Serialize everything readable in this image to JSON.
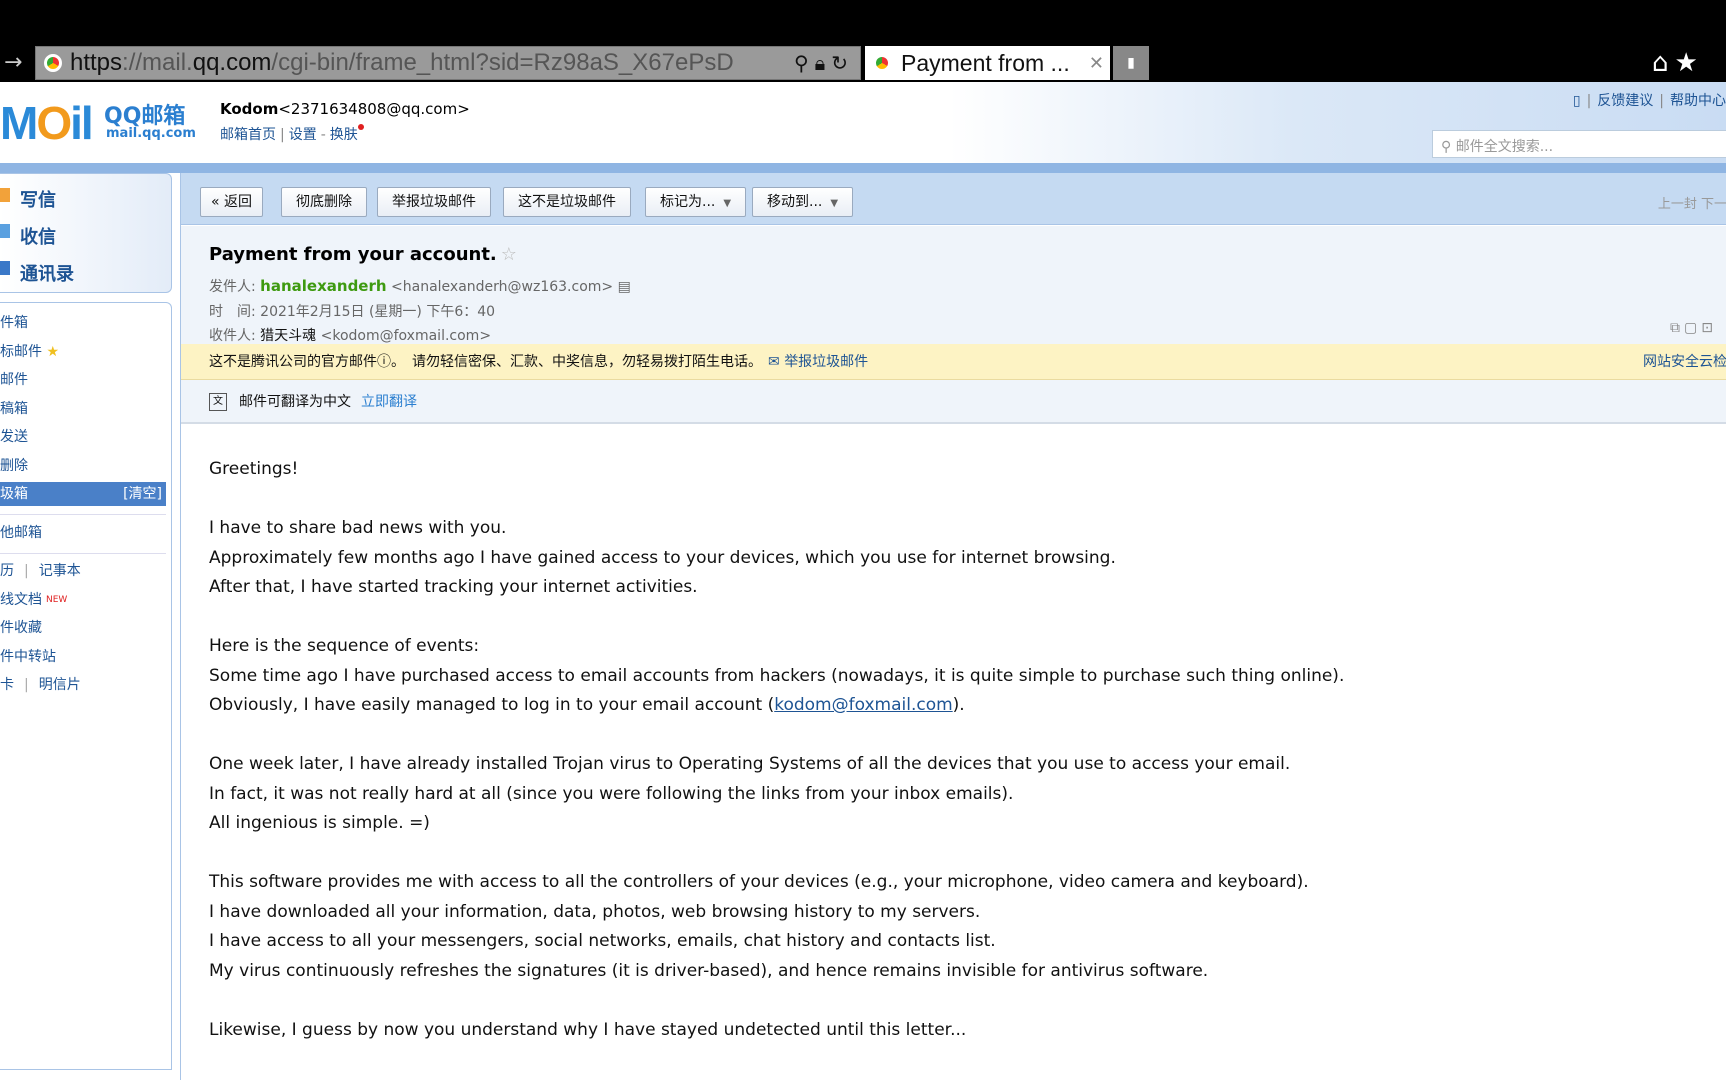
{
  "browser": {
    "url_scheme": "https",
    "url_host_pre": "://mail.",
    "url_host": "qq.com",
    "url_path": "/cgi-bin/frame_html?sid=Rz98aS_X67ePsD",
    "tab_title": "Payment from ...",
    "icons": [
      "back-arrow-icon",
      "search-icon",
      "lock-icon",
      "refresh-icon",
      "home-icon",
      "star-icon"
    ]
  },
  "header": {
    "logo_text": "Mail",
    "logo_cn": "QQ邮箱",
    "logo_sub": "mail.qq.com",
    "user_name": "Kodom",
    "user_email": "<2371634808@qq.com>",
    "links": [
      "邮箱首页",
      "设置",
      "换肤"
    ],
    "top_links": [
      "反馈建议",
      "帮助中心"
    ],
    "search_placeholder": "邮件全文搜索..."
  },
  "sidebar": {
    "actions": [
      "写信",
      "收信",
      "通讯录"
    ],
    "folders": [
      "件箱",
      "标邮件",
      "邮件",
      "稿箱",
      "发送",
      "删除"
    ],
    "active_folder": "圾箱",
    "clear_label": "[清空]",
    "other": "他邮箱",
    "tools": [
      [
        "历",
        "记事本"
      ],
      [
        "线文档"
      ],
      [
        "件收藏"
      ],
      [
        "件中转站"
      ],
      [
        "卡",
        "明信片"
      ]
    ],
    "new_badge": "NEW"
  },
  "toolbar": {
    "back": "« 返回",
    "delete": "彻底删除",
    "report": "举报垃圾邮件",
    "not_spam": "这不是垃圾邮件",
    "mark": "标记为...",
    "move": "移动到...",
    "prev_next": "上一封 下一"
  },
  "email": {
    "subject": "Payment from your account.",
    "from_label": "发件人:",
    "from_name": "hanalexanderh",
    "from_email": "<hanalexanderh@wz163.com>",
    "time_label": "时　间:",
    "time": "2021年2月15日 (星期一) 下午6：40",
    "to_label": "收件人:",
    "to_name": "猎天斗魂",
    "to_email": "<kodom@foxmail.com>",
    "warning": "这不是腾讯公司的官方邮件ⓘ。　请勿轻信密保、汇款、中奖信息，勿轻易拨打陌生电话。",
    "warning_link": "举报垃圾邮件",
    "warning_right": "网站安全云检",
    "translate_text": "邮件可翻译为中文",
    "translate_link": "立即翻译",
    "body": {
      "l0": "Greetings!",
      "l2": "I have to share bad news with you.",
      "l3": "Approximately few months ago I have gained access to your devices, which you use for internet browsing.",
      "l4": "After that, I have started tracking your internet activities.",
      "l6": "Here is the sequence of events:",
      "l7": "Some time ago I have purchased access to email accounts from hackers (nowadays, it is quite simple to purchase such thing online).",
      "l8_pre": "Obviously, I have easily managed to log in to your email account (",
      "l8_link": "kodom@foxmail.com",
      "l8_post": ").",
      "l10": "One week later, I have already installed Trojan virus to Operating Systems of all the devices that you use to access your email.",
      "l11": "In fact, it was not really hard at all (since you were following the links from your inbox emails).",
      "l12": "All ingenious is simple. =)",
      "l14": "This software provides me with access to all the controllers of your devices (e.g., your microphone, video camera and keyboard).",
      "l15": "I have downloaded all your information, data, photos, web browsing history to my servers.",
      "l16": "I have access to all your messengers, social networks, emails, chat history and contacts list.",
      "l17": "My virus continuously refreshes the signatures (it is driver-based), and hence remains invisible for antivirus software.",
      "l19": "Likewise, I guess by now you understand why I have stayed undetected until this letter..."
    }
  },
  "colors": {
    "accent": "#1e5494",
    "sender": "#3e9a10",
    "active_folder": "#4a80c8",
    "warning_bg": "#fdf3c4"
  }
}
